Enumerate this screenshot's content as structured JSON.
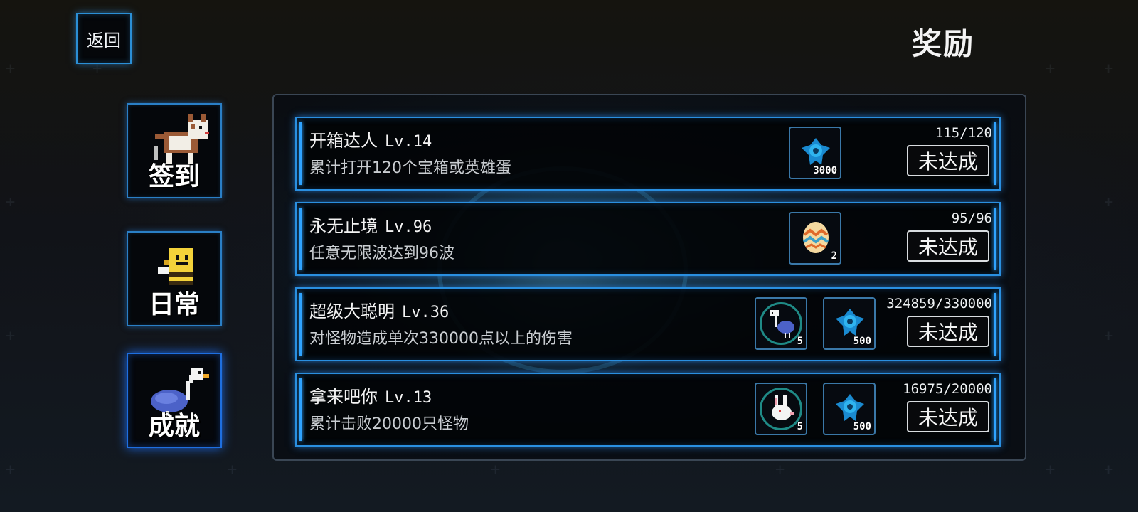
{
  "header": {
    "back_label": "返回",
    "title": "奖励"
  },
  "tabs": [
    {
      "label": "签到",
      "icon": "dog-icon",
      "active": false
    },
    {
      "label": "日常",
      "icon": "bee-icon",
      "active": false
    },
    {
      "label": "成就",
      "icon": "ostrich-icon",
      "active": true
    }
  ],
  "achievements": [
    {
      "title": "开箱达人",
      "level": "Lv.14",
      "desc": "累计打开120个宝箱或英雄蛋",
      "progress": "115/120",
      "status": "未达成",
      "rewards": [
        {
          "icon": "blue-crystal-icon",
          "count": "3000"
        }
      ]
    },
    {
      "title": "永无止境",
      "level": "Lv.96",
      "desc": "任意无限波达到96波",
      "progress": "95/96",
      "status": "未达成",
      "rewards": [
        {
          "icon": "hero-egg-icon",
          "count": "2"
        }
      ]
    },
    {
      "title": "超级大聪明",
      "level": "Lv.36",
      "desc": "对怪物造成单次330000点以上的伤害",
      "progress": "324859/330000",
      "status": "未达成",
      "rewards": [
        {
          "icon": "ostrich-pet-icon",
          "count": "5"
        },
        {
          "icon": "blue-crystal-icon",
          "count": "500"
        }
      ]
    },
    {
      "title": "拿来吧你",
      "level": "Lv.13",
      "desc": "累计击败20000只怪物",
      "progress": "16975/20000",
      "status": "未达成",
      "rewards": [
        {
          "icon": "rabbit-pet-icon",
          "count": "5"
        },
        {
          "icon": "blue-crystal-icon",
          "count": "500"
        }
      ]
    }
  ],
  "colors": {
    "accent": "#2a8fe0",
    "panel_border": "#3a4654",
    "text": "#f3f3f3"
  }
}
